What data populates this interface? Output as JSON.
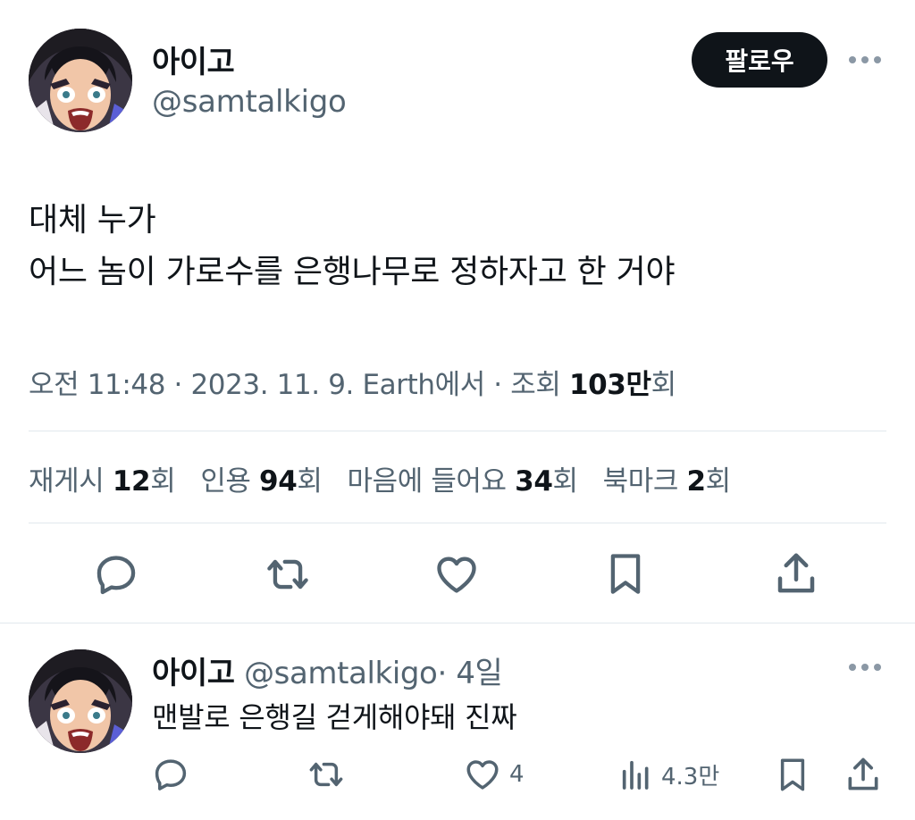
{
  "tweet": {
    "author": {
      "display_name": "아이고",
      "handle": "@samtalkigo",
      "avatar_icon": "avatar-shocked-anime-character"
    },
    "follow_label": "팔로우",
    "text_lines": [
      "대체 누가",
      "어느 놈이 가로수를 은행나무로 정하자고 한 거야"
    ],
    "meta": {
      "time": "오전 11:48",
      "sep1": "·",
      "date": "2023. 11. 9.",
      "source": "Earth에서",
      "sep2": "·",
      "views_label": "조회",
      "views_value": "103만",
      "views_suffix": "회"
    },
    "stats": [
      {
        "label": "재게시",
        "value": "12",
        "suffix": "회"
      },
      {
        "label": "인용",
        "value": "94",
        "suffix": "회"
      },
      {
        "label": "마음에 들어요",
        "value": "34",
        "suffix": "회"
      },
      {
        "label": "북마크",
        "value": "2",
        "suffix": "회"
      }
    ],
    "actions": [
      "reply-icon",
      "retweet-icon",
      "like-icon",
      "bookmark-icon",
      "share-icon"
    ]
  },
  "reply": {
    "display_name": "아이고",
    "handle": "@samtalkigo",
    "separator": "·",
    "time": "4일",
    "text": "맨발로 은행길 걷게해야돼 진짜",
    "like_count": "4",
    "views_count": "4.3만",
    "actions": [
      "reply-icon",
      "retweet-icon",
      "like-icon",
      "views-icon",
      "bookmark-icon",
      "share-icon"
    ]
  },
  "colors": {
    "text_primary": "#0f1419",
    "text_secondary": "#536471",
    "divider": "#e1e8ed",
    "follow_bg": "#0f1419"
  }
}
